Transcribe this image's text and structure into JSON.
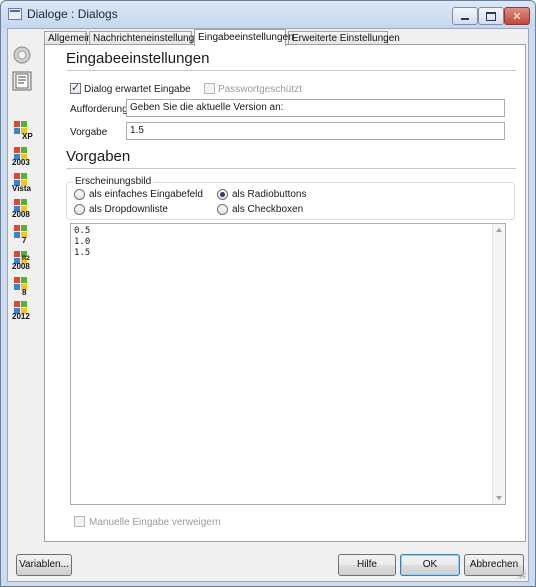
{
  "window": {
    "title": "Dialoge : Dialogs"
  },
  "sidebar": {
    "items": [
      {
        "icon": "settings-disc-icon"
      },
      {
        "icon": "document-icon"
      },
      {
        "icon": "windows-logo-icon",
        "label": "XP"
      },
      {
        "icon": "windows-logo-icon",
        "label": "2003"
      },
      {
        "icon": "windows-logo-icon",
        "label": "Vista"
      },
      {
        "icon": "windows-logo-icon",
        "label": "2008"
      },
      {
        "icon": "windows-logo-icon",
        "label": "7"
      },
      {
        "icon": "windows-logo-icon",
        "label": "2008",
        "label2": "R2"
      },
      {
        "icon": "windows-logo-icon",
        "label": "8"
      },
      {
        "icon": "windows-logo-icon",
        "label": "2012"
      }
    ]
  },
  "tabs": [
    {
      "label": "Allgemein",
      "active": false
    },
    {
      "label": "Nachrichteneinstellungen",
      "active": false
    },
    {
      "label": "Eingabeeinstellungen",
      "active": true
    },
    {
      "label": "Erweiterte Einstellungen",
      "active": false
    }
  ],
  "input_section": {
    "title": "Eingabeeinstellungen",
    "expects_input_label": "Dialog erwartet Eingabe",
    "expects_input_checked": true,
    "password_label": "Passwortgeschützt",
    "password_checked": false,
    "prompt_label": "Aufforderung",
    "prompt_value": "Geben Sie die aktuelle Version an:",
    "default_label": "Vorgabe",
    "default_value": "1.5"
  },
  "defaults_section": {
    "title": "Vorgaben",
    "appearance_legend": "Erscheinungsbild",
    "radios": [
      {
        "label": "als einfaches Eingabefeld",
        "checked": false
      },
      {
        "label": "als Radiobuttons",
        "checked": true
      },
      {
        "label": "als Dropdownliste",
        "checked": false
      },
      {
        "label": "als Checkboxen",
        "checked": false
      }
    ],
    "values": [
      "0.5",
      "1.0",
      "1.5"
    ],
    "deny_manual_label": "Manuelle Eingabe verweigern",
    "deny_manual_checked": false
  },
  "buttons": {
    "variables": "Variablen...",
    "help": "Hilfe",
    "ok": "OK",
    "cancel": "Abbrechen"
  },
  "colors": {
    "title_bar": "#c6d7ee",
    "close_button": "#c1473a",
    "panel_bg": "#ffffff",
    "dialog_bg": "#f0f0f0"
  }
}
